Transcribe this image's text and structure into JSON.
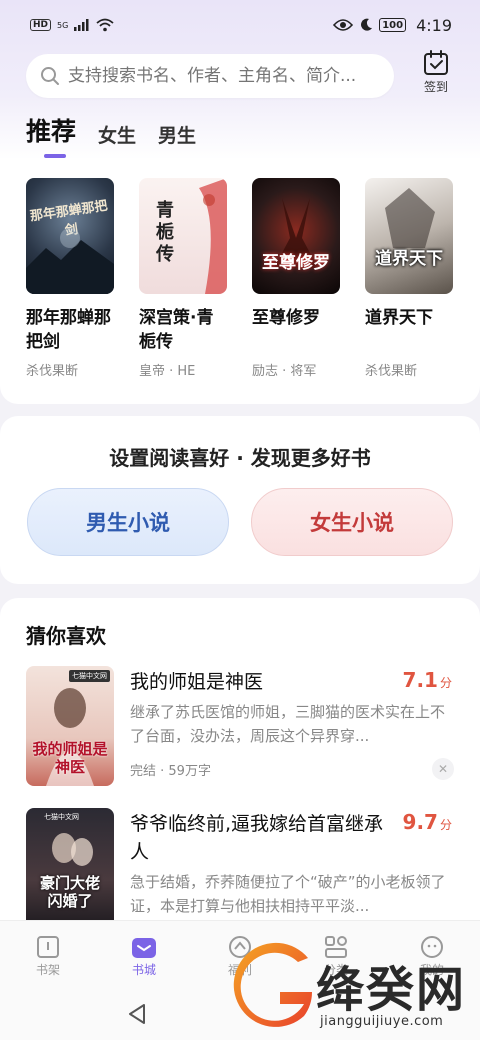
{
  "status": {
    "network": "5G",
    "hd": "HD",
    "battery": "100",
    "time": "4:19"
  },
  "search": {
    "placeholder": "支持搜索书名、作者、主角名、简介..."
  },
  "signin": {
    "label": "签到"
  },
  "tabs": [
    {
      "label": "推荐",
      "active": true
    },
    {
      "label": "女生",
      "active": false
    },
    {
      "label": "男生",
      "active": false
    }
  ],
  "featured": [
    {
      "title": "那年那蝉那把剑",
      "meta": "杀伐果断",
      "cover_text": "那年那蝉那把剑",
      "colors": [
        "#2b3748",
        "#0f1620"
      ]
    },
    {
      "title": "深宫策·青栀传",
      "meta": "皇帝 · HE",
      "cover_text": "青栀传",
      "colors": [
        "#f7ecec",
        "#e8d0d0"
      ]
    },
    {
      "title": "至尊修罗",
      "meta": "励志 · 将军",
      "cover_text": "至尊修罗",
      "colors": [
        "#2a1a1a",
        "#0b0606"
      ]
    },
    {
      "title": "道界天下",
      "meta": "杀伐果断",
      "cover_text": "道界天下",
      "colors": [
        "#e0dcd8",
        "#7a726a"
      ]
    }
  ],
  "preference": {
    "title": "设置阅读喜好 · 发现更多好书",
    "male_label": "男生小说",
    "female_label": "女生小说"
  },
  "guess": {
    "title": "猜你喜欢",
    "items": [
      {
        "name": "我的师姐是神医",
        "score": "7.1",
        "unit": "分",
        "desc": "继承了苏氏医馆的师姐，三脚猫的医术实在上不了台面，没办法，周辰这个异界穿...",
        "meta": "完结 · 59万字",
        "cover_text": "我的师姐是神医",
        "publisher": "七猫中文网"
      },
      {
        "name": "爷爷临终前,逼我嫁给首富继承人",
        "score": "9.7",
        "unit": "分",
        "desc": "急于结婚，乔荞随便拉了个“破产”的小老板领了证，本是打算与他相扶相持平平淡...",
        "meta": "",
        "cover_text": "豪门大佬闪婚了",
        "publisher": "七猫中文网"
      }
    ]
  },
  "bottom_nav": [
    {
      "label": "书架",
      "active": false
    },
    {
      "label": "书城",
      "active": true
    },
    {
      "label": "福利",
      "active": false
    },
    {
      "label": "分类",
      "active": false
    },
    {
      "label": "我的",
      "active": false
    }
  ],
  "watermark": {
    "text": "绛癸网",
    "sub": "jiangguijiuye.com"
  },
  "colors": {
    "accent": "#7b63e6",
    "score": "#e05540",
    "male": "#2f5bb0",
    "female": "#c33a3a"
  }
}
